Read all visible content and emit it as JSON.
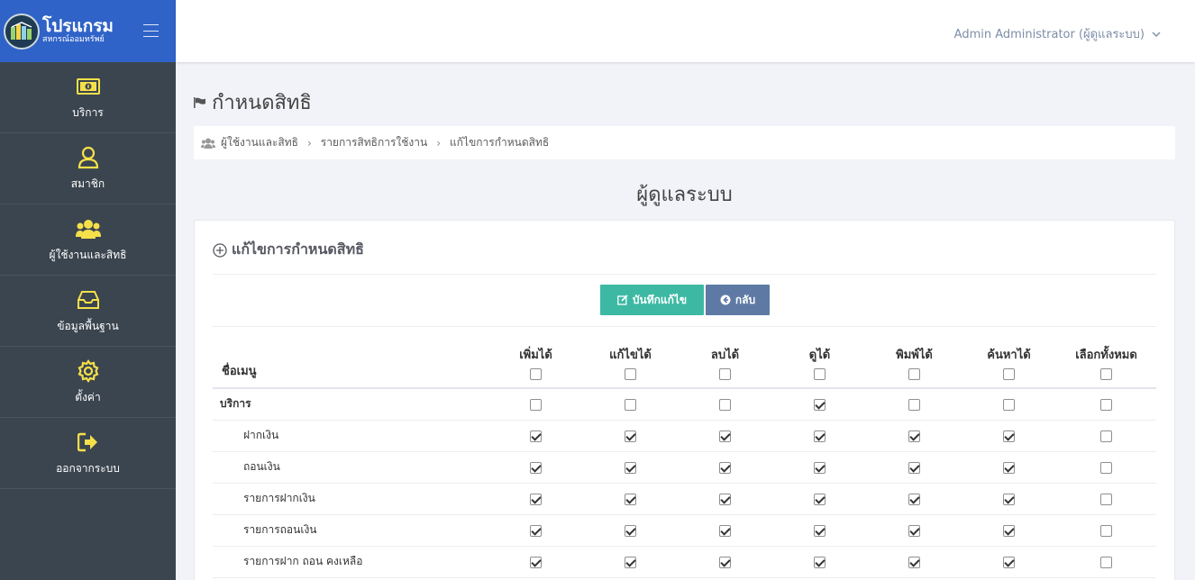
{
  "brand": {
    "title": "โปรแกรม",
    "subtitle": "สหกรณ์ออมทรัพย์"
  },
  "sidebar": {
    "items": [
      {
        "label": "บริการ",
        "icon": "money-icon"
      },
      {
        "label": "สมาชิก",
        "icon": "user-icon"
      },
      {
        "label": "ผู้ใช้งานและสิทธิ",
        "icon": "users-icon"
      },
      {
        "label": "ข้อมูลพื้นฐาน",
        "icon": "inbox-icon"
      },
      {
        "label": "ตั้งค่า",
        "icon": "gear-icon"
      },
      {
        "label": "ออกจากระบบ",
        "icon": "sign-out-icon"
      }
    ]
  },
  "topbar": {
    "user": "Admin Administrator (ผู้ดูแลระบบ)"
  },
  "page": {
    "title": "กำหนดสิทธิ",
    "breadcrumb": [
      "ผู้ใช้งานและสิทธิ",
      "รายการสิทธิการใช้งาน",
      "แก้ไขการกำหนดสิทธิ"
    ],
    "heading": "ผู้ดูแลระบบ"
  },
  "card": {
    "title": "แก้ไขการกำหนดสิทธิ",
    "save_label": "บันทึกแก้ไข",
    "back_label": "กลับ"
  },
  "table": {
    "name_header": "ชื่อเมนู",
    "columns": [
      "เพิ่มได้",
      "แก้ไขได้",
      "ลบได้",
      "ดูได้",
      "พิมพ์ได้",
      "ค้นหาได้",
      "เลือกทั้งหมด"
    ],
    "header_checks": [
      false,
      false,
      false,
      false,
      false,
      false,
      false
    ],
    "rows": [
      {
        "name": "บริการ",
        "parent": true,
        "checks": [
          false,
          false,
          false,
          true,
          false,
          false,
          false
        ]
      },
      {
        "name": "ฝากเงิน",
        "parent": false,
        "checks": [
          true,
          true,
          true,
          true,
          true,
          true,
          false
        ]
      },
      {
        "name": "ถอนเงิน",
        "parent": false,
        "checks": [
          true,
          true,
          true,
          true,
          true,
          true,
          false
        ]
      },
      {
        "name": "รายการฝากเงิน",
        "parent": false,
        "checks": [
          true,
          true,
          true,
          true,
          true,
          true,
          false
        ]
      },
      {
        "name": "รายการถอนเงิน",
        "parent": false,
        "checks": [
          true,
          true,
          true,
          true,
          true,
          true,
          false
        ]
      },
      {
        "name": "รายการฝาก ถอน คงเหลือ",
        "parent": false,
        "checks": [
          true,
          true,
          true,
          true,
          true,
          true,
          false
        ]
      }
    ]
  },
  "colors": {
    "sidebar_bg": "#3b454f",
    "brand_bg": "#2f63c8",
    "icon_yellow": "#f5e04a",
    "save_btn": "#3db9a3",
    "back_btn": "#5e7aa4"
  }
}
